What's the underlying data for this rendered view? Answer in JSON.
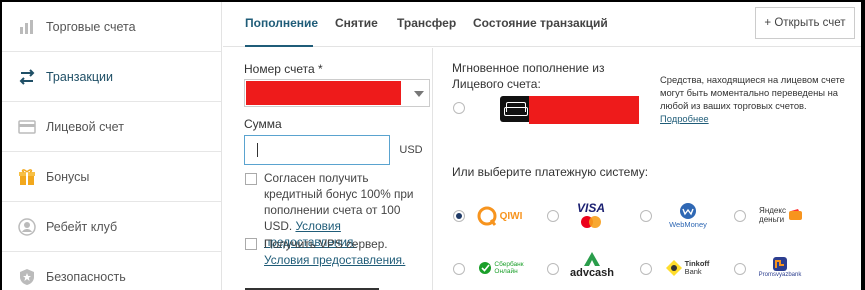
{
  "sidebar": {
    "items": [
      {
        "label": "Торговые счета",
        "icon": "bar-chart-icon",
        "active": false
      },
      {
        "label": "Транзакции",
        "icon": "transfer-arrows-icon",
        "active": true
      },
      {
        "label": "Лицевой счет",
        "icon": "wallet-icon",
        "active": false
      },
      {
        "label": "Бонусы",
        "icon": "gift-icon",
        "active": false
      },
      {
        "label": "Ребейт клуб",
        "icon": "user-icon",
        "active": false
      },
      {
        "label": "Безопасность",
        "icon": "shield-icon",
        "active": false
      }
    ]
  },
  "tabs": [
    {
      "label": "Пополнение",
      "active": true
    },
    {
      "label": "Снятие",
      "active": false
    },
    {
      "label": "Трансфер",
      "active": false
    },
    {
      "label": "Состояние транзакций",
      "active": false
    }
  ],
  "open_account_button": "+ Открыть счет",
  "form": {
    "account_label": "Номер счета *",
    "amount_label": "Сумма",
    "amount_value": "",
    "currency": "USD",
    "checkbox_credit_text": "Согласен получить кредитный бонус 100% при пополнении счета от 100 USD.",
    "checkbox_credit_link": "Условия предоставления.",
    "checkbox_credit_checked": false,
    "checkbox_vps_text": "Получить VPS сервер.",
    "checkbox_vps_link": "Условия предоставления.",
    "checkbox_vps_checked": false
  },
  "instant": {
    "label": "Мгновенное пополнение из Лицевого счета:",
    "info_text": "Средства, находящиеся на лицевом счете могут быть моментально переведены на любой из ваших торговых счетов.",
    "info_link": "Подробнее",
    "selected": false
  },
  "payment": {
    "label": "Или выберите платежную систему:",
    "selected": "QIWI",
    "methods": [
      {
        "name": "QIWI",
        "selected": true
      },
      {
        "name": "VISA MasterCard",
        "selected": false
      },
      {
        "name": "WebMoney",
        "selected": false
      },
      {
        "name": "Яндекс деньги",
        "selected": false
      },
      {
        "name": "Сбербанк Онлайн",
        "selected": false
      },
      {
        "name": "advcash",
        "selected": false
      },
      {
        "name": "Tinkoff Bank",
        "selected": false
      },
      {
        "name": "Promsvyazbank",
        "selected": false
      }
    ],
    "logo_text": {
      "qiwi": "QIWI",
      "visa": "VISA",
      "webmoney": "WebMoney",
      "yandex_line1": "Яндекс",
      "yandex_line2": "деньги",
      "sber_line1": "Сбербанк",
      "sber_line2": "Онлайн",
      "advcash": "advcash",
      "tinkoff_line1": "Tinkoff",
      "tinkoff_line2": "Bank",
      "psb": "Promsvyazbank"
    }
  },
  "colors": {
    "accent": "#1f5c78",
    "redacted": "#ee1b1b",
    "input_focus": "#5aa3cf",
    "qiwi_orange": "#f7941e",
    "visa_blue": "#1a1f71",
    "sber_green": "#1a9f29",
    "yandex_red": "#ff3333"
  }
}
